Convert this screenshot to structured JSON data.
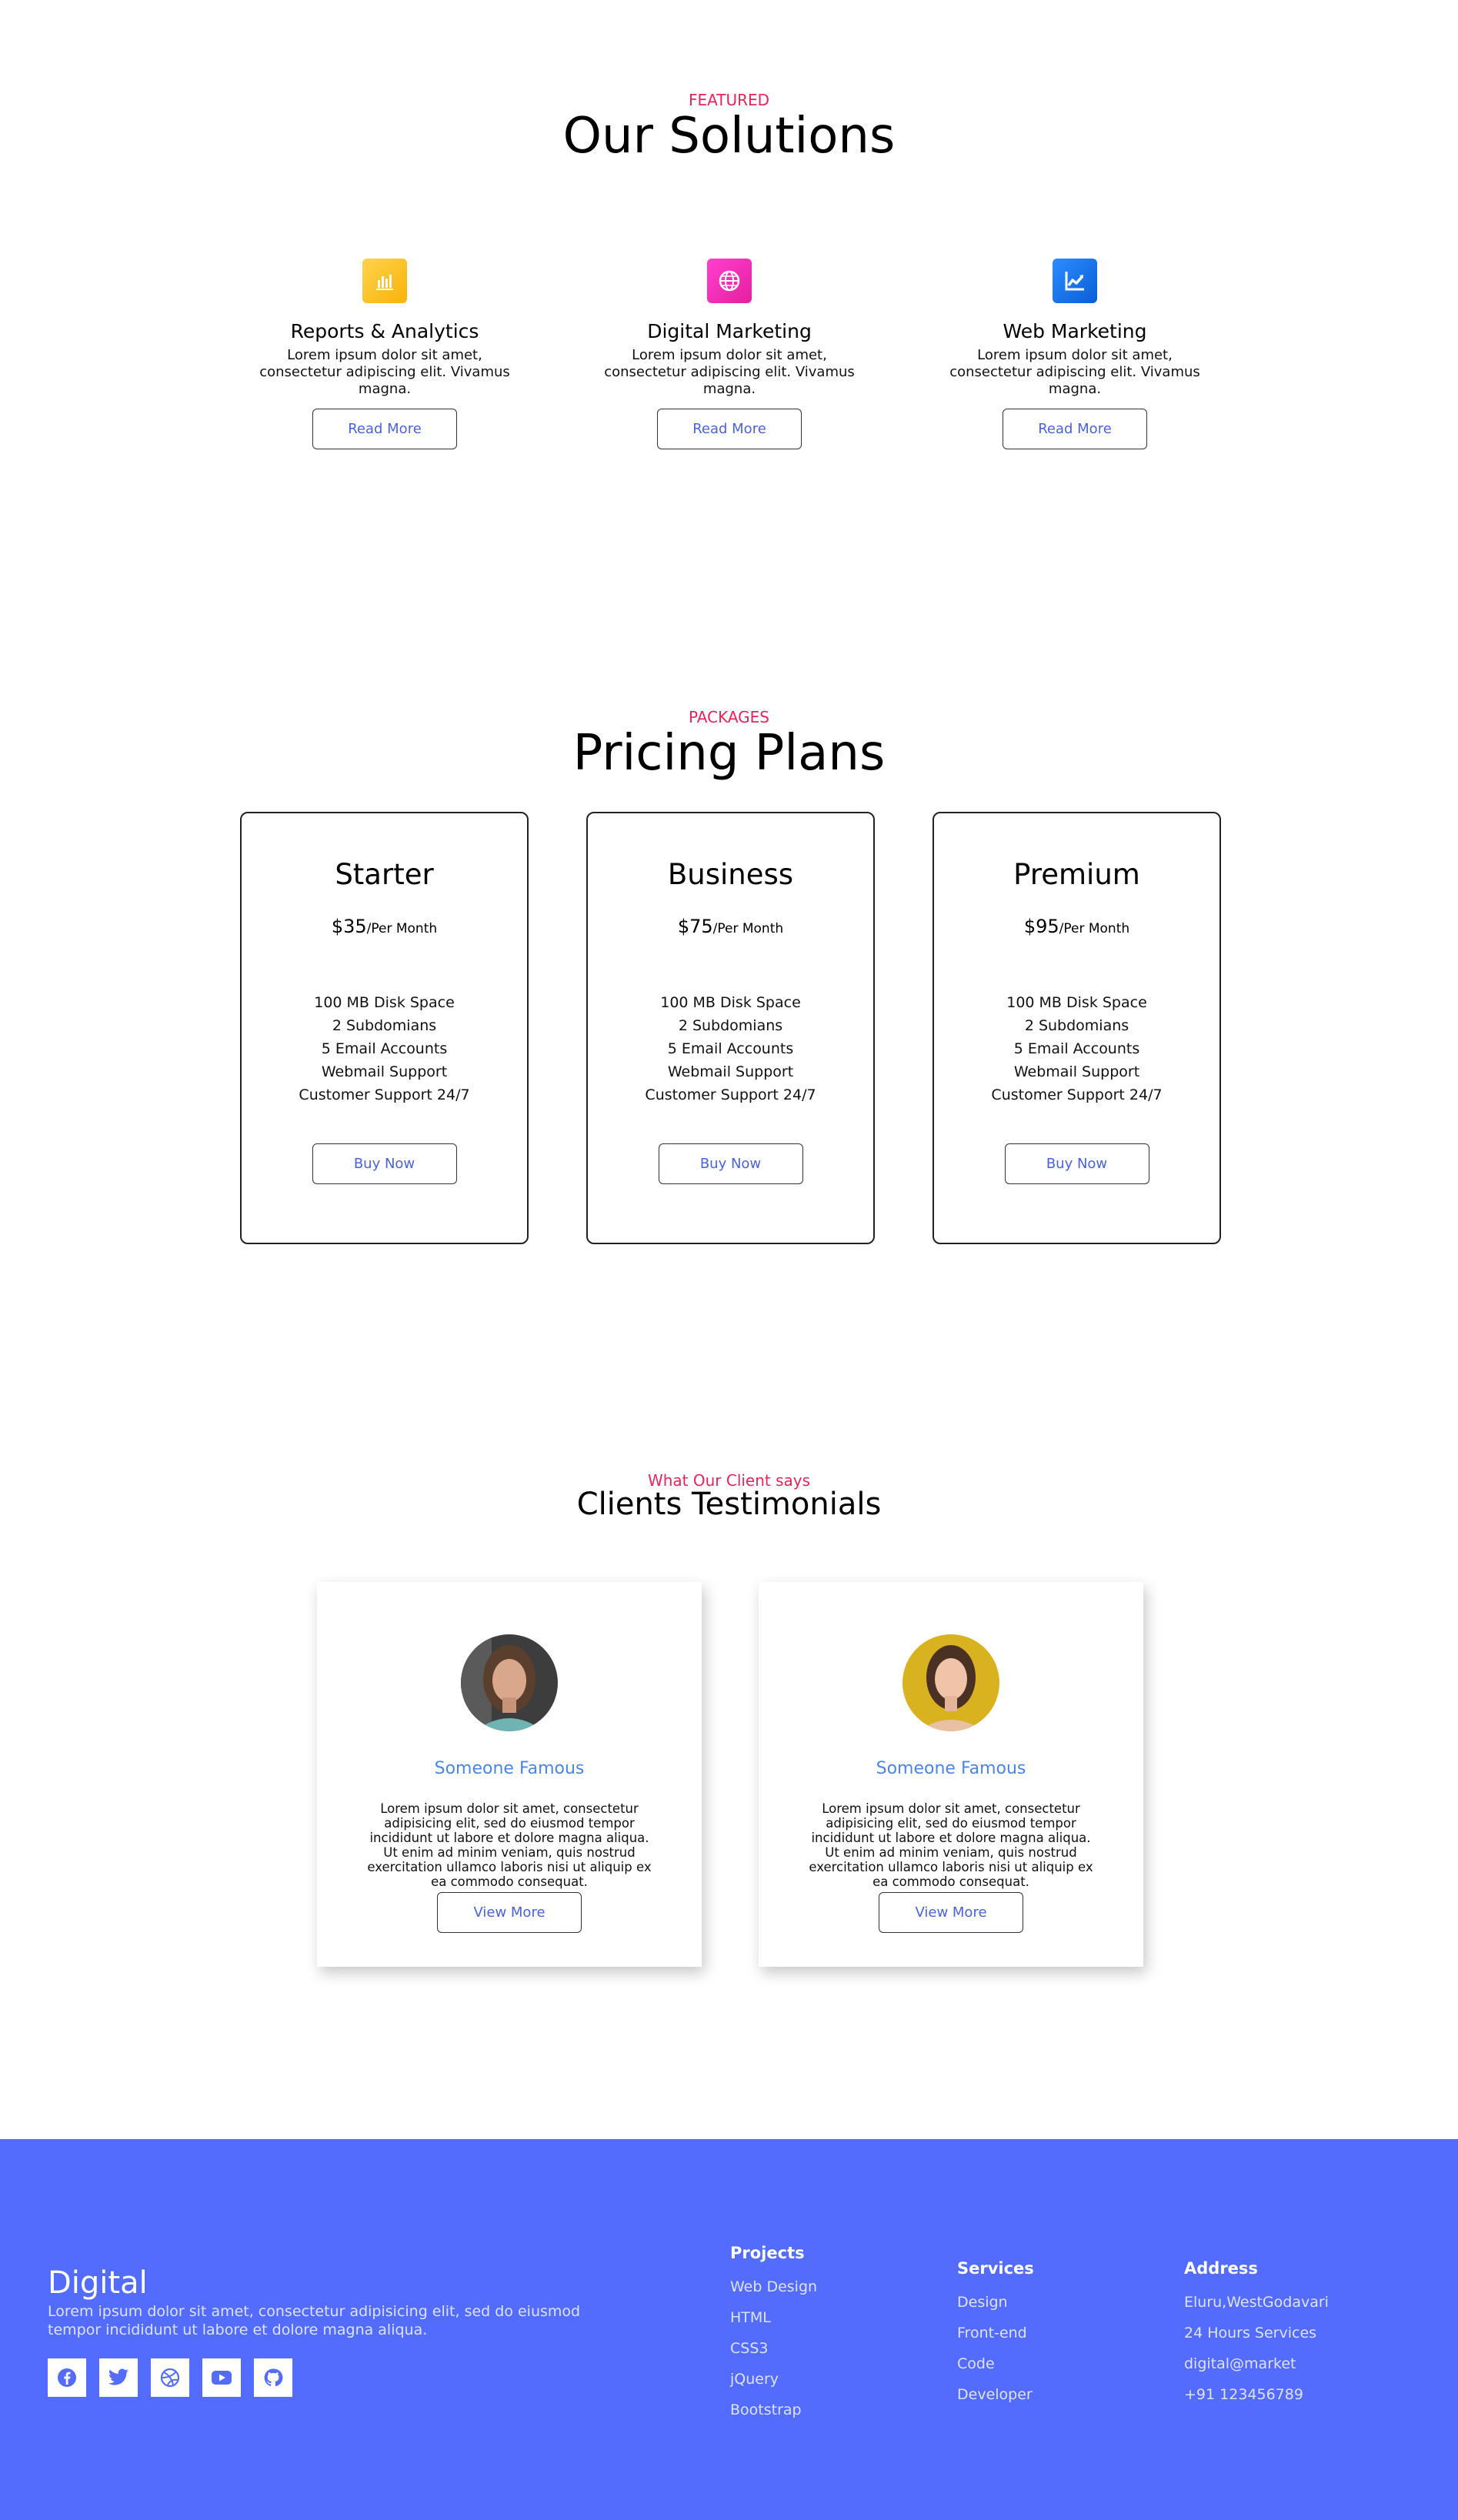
{
  "solutions": {
    "eyebrow": "FEATURED",
    "title": "Our Solutions",
    "cards": [
      {
        "icon": "bar-chart-icon",
        "color": "#fbc02d",
        "title": "Reports & Analytics",
        "desc": "Lorem ipsum dolor sit amet, consectetur adipiscing elit. Vivamus magna.",
        "button": "Read More"
      },
      {
        "icon": "globe-icon",
        "color": "#ef2fb9",
        "title": "Digital Marketing",
        "desc": "Lorem ipsum dolor sit amet, consectetur adipiscing elit. Vivamus magna.",
        "button": "Read More"
      },
      {
        "icon": "trending-chart-icon",
        "color": "#1a73e8",
        "title": "Web Marketing",
        "desc": "Lorem ipsum dolor sit amet, consectetur adipiscing elit. Vivamus magna.",
        "button": "Read More"
      }
    ]
  },
  "pricing": {
    "eyebrow": "PACKAGES",
    "title": "Pricing Plans",
    "plans": [
      {
        "name": "Starter",
        "price": "$35",
        "period": "/Per Month",
        "features": [
          "100 MB Disk Space",
          "2 Subdomians",
          "5 Email Accounts",
          "Webmail Support",
          "Customer Support 24/7"
        ],
        "button": "Buy Now"
      },
      {
        "name": "Business",
        "price": "$75",
        "period": "/Per Month",
        "features": [
          "100 MB Disk Space",
          "2 Subdomians",
          "5 Email Accounts",
          "Webmail Support",
          "Customer Support 24/7"
        ],
        "button": "Buy Now"
      },
      {
        "name": "Premium",
        "price": "$95",
        "period": "/Per Month",
        "features": [
          "100 MB Disk Space",
          "2 Subdomians",
          "5 Email Accounts",
          "Webmail Support",
          "Customer Support 24/7"
        ],
        "button": "Buy Now"
      }
    ]
  },
  "testimonials": {
    "eyebrow": "What Our Client says",
    "title": "Clients Testimonials",
    "items": [
      {
        "name": "Someone Famous",
        "text": "Lorem ipsum dolor sit amet, consectetur adipisicing elit, sed do eiusmod tempor incididunt ut labore et dolore magna aliqua. Ut enim ad minim veniam, quis nostrud exercitation ullamco laboris nisi ut aliquip ex ea commodo consequat.",
        "button": "View More"
      },
      {
        "name": "Someone Famous",
        "text": "Lorem ipsum dolor sit amet, consectetur adipisicing elit, sed do eiusmod tempor incididunt ut labore et dolore magna aliqua. Ut enim ad minim veniam, quis nostrud exercitation ullamco laboris nisi ut aliquip ex ea commodo consequat.",
        "button": "View More"
      }
    ]
  },
  "footer": {
    "brand": "Digital",
    "desc": "Lorem ipsum dolor sit amet, consectetur adipisicing elit, sed do eiusmod tempor incididunt ut labore et dolore magna aliqua.",
    "socials": [
      "facebook-icon",
      "twitter-icon",
      "dribbble-icon",
      "youtube-icon",
      "github-icon"
    ],
    "projects": {
      "title": "Projects",
      "items": [
        "Web Design",
        "HTML",
        "CSS3",
        "jQuery",
        "Bootstrap"
      ]
    },
    "services": {
      "title": "Services",
      "items": [
        "Design",
        "Front-end",
        "Code",
        "Developer"
      ]
    },
    "address": {
      "title": "Address",
      "items": [
        "Eluru,WestGodavari",
        "24 Hours Services",
        "digital@market",
        "+91 123456789"
      ]
    }
  },
  "colors": {
    "accent": "#e8245b",
    "link": "#4a63d9",
    "footer": "#536cfe"
  }
}
